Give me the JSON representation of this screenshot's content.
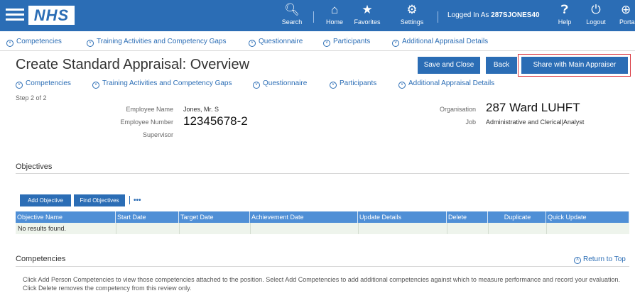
{
  "header": {
    "logo": "NHS",
    "items": [
      {
        "label": "Search",
        "icon": "search-icon"
      },
      {
        "label": "Home",
        "icon": "home-icon"
      },
      {
        "label": "Favorites",
        "icon": "star-icon"
      },
      {
        "label": "Settings",
        "icon": "gear-icon"
      }
    ],
    "logged_in_prefix": "Logged In As",
    "user": "287SJONES40",
    "right_items": [
      {
        "label": "Help",
        "icon": "help-icon"
      },
      {
        "label": "Logout",
        "icon": "power-icon"
      },
      {
        "label": "Portal",
        "icon": "globe-icon"
      }
    ]
  },
  "quick_nav": {
    "items": [
      "Competencies",
      "Training Activities and Competency Gaps",
      "Questionnaire",
      "Participants",
      "Additional Appraisal Details"
    ]
  },
  "page": {
    "title": "Create Standard Appraisal: Overview",
    "buttons": {
      "save_close": "Save and Close",
      "back": "Back",
      "share": "Share with Main Appraiser"
    },
    "step": "Step 2 of 2"
  },
  "employee": {
    "name_label": "Employee Name",
    "name": "Jones, Mr. S",
    "number_label": "Employee Number",
    "number": "12345678-2",
    "supervisor_label": "Supervisor",
    "organisation_label": "Organisation",
    "organisation": "287 Ward LUHFT",
    "job_label": "Job",
    "job": "Administrative and Clerical|Analyst"
  },
  "objectives": {
    "heading": "Objectives",
    "add_button": "Add Objective",
    "find_button": "Find Objectives",
    "more": "•••",
    "columns": [
      "Objective Name",
      "Start Date",
      "Target Date",
      "Achievement Date",
      "Update Details",
      "Delete",
      "Duplicate",
      "Quick Update"
    ],
    "empty": "No results found."
  },
  "competencies": {
    "heading": "Competencies",
    "return_top": "Return to Top",
    "instructions": "Click Add Person Competencies to view those competencies attached to the position. Select Add Competencies to add additional competencies against which to measure performance and record your evaluation. Click Delete removes the competency from this review only."
  }
}
